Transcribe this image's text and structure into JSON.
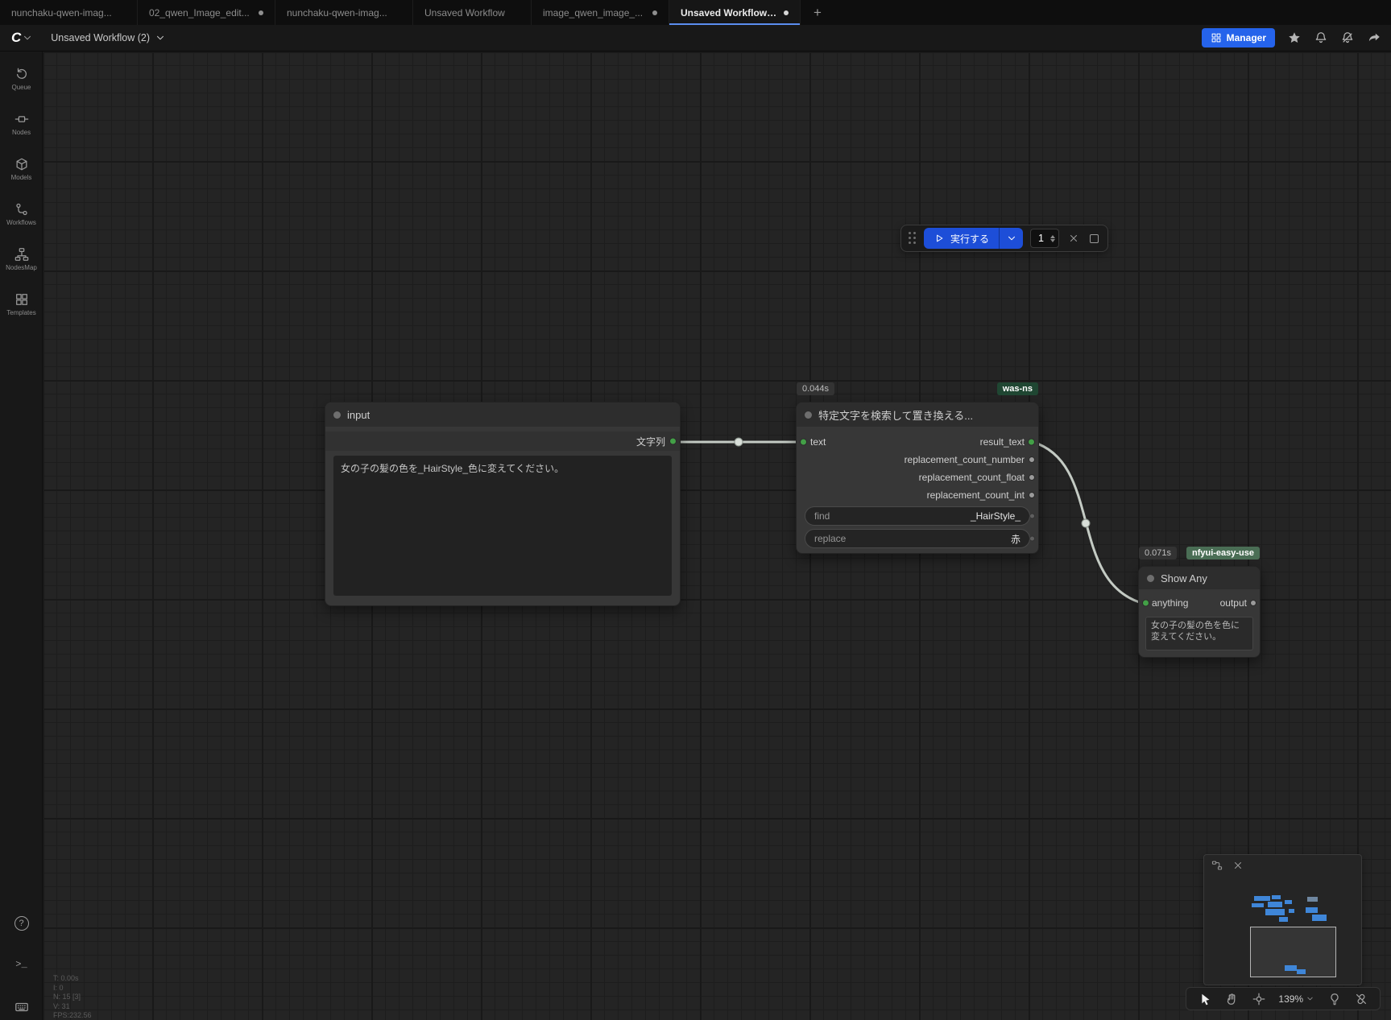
{
  "colors": {
    "accent_blue": "#2563eb",
    "tab_underline": "#5b8def",
    "run_button_blue": "#1d4ed8",
    "wire": "#cdd5cd",
    "slot_green": "#43a047",
    "badge_green_wasns": "#1f4632",
    "badge_green_easyuse": "#4a6e55",
    "minimap_node_blue": "#3f86d8"
  },
  "icons": {
    "logo": "C",
    "help": "?",
    "terminal": ">_"
  },
  "tabbar": {
    "tabs": [
      {
        "label": "nunchaku-qwen-imag..."
      },
      {
        "label": "02_qwen_Image_edit..."
      },
      {
        "label": "nunchaku-qwen-imag..."
      },
      {
        "label": "Unsaved Workflow"
      },
      {
        "label": "image_qwen_image_..."
      },
      {
        "label": "Unsaved Workflow (2)"
      }
    ],
    "new_tab": "+"
  },
  "menubar": {
    "workflow_title": "Unsaved Workflow (2)",
    "manager_label": "Manager"
  },
  "sidebar": {
    "items": [
      {
        "label": "Queue"
      },
      {
        "label": "Nodes"
      },
      {
        "label": "Models"
      },
      {
        "label": "Workflows"
      },
      {
        "label": "NodesMap"
      },
      {
        "label": "Templates"
      }
    ]
  },
  "run_toolbar": {
    "run_label": "実行する",
    "count": "1"
  },
  "nodes": {
    "input": {
      "title": "input",
      "output_label": "文字列",
      "text": "女の子の髪の色を_HairStyle_色に変えてください。"
    },
    "replace": {
      "time_badge": "0.044s",
      "pack_badge": "was-ns",
      "title": "特定文字を検索して置き換える...",
      "input_label": "text",
      "outputs": [
        "result_text",
        "replacement_count_number",
        "replacement_count_float",
        "replacement_count_int"
      ],
      "find_label": "find",
      "find_value": "_HairStyle_",
      "replace_label": "replace",
      "replace_value": "赤"
    },
    "show_any": {
      "time_badge": "0.071s",
      "pack_badge": "nfyui-easy-use",
      "title": "Show Any",
      "input_label": "anything",
      "output_label": "output",
      "text": "女の子の髪の色を色に変えてください。"
    }
  },
  "zoom_controls": {
    "zoom_level": "139%"
  },
  "stats": {
    "lines": [
      "T: 0.00s",
      "I: 0",
      "N: 15 [3]",
      "V: 31",
      "FPS:232.56"
    ]
  }
}
